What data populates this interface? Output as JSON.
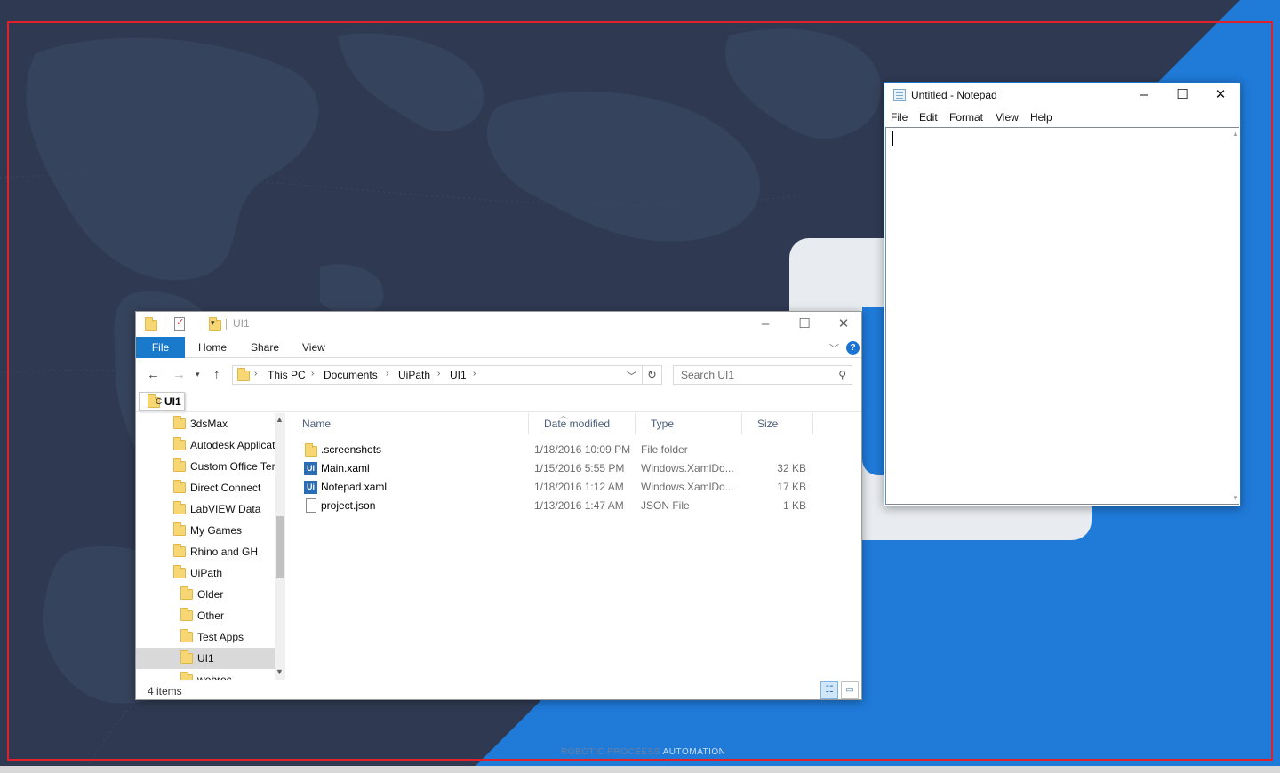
{
  "desktop": {
    "caption_dim": "ROBOTIC PROCEESS",
    "caption_bright": "AUTOMATION"
  },
  "explorer": {
    "title": "UI1",
    "ribbon_tabs": [
      "File",
      "Home",
      "Share",
      "View"
    ],
    "help_label": "?",
    "breadcrumb": [
      "This PC",
      "Documents",
      "UiPath",
      "UI1"
    ],
    "search_placeholder": "Search UI1",
    "drag_tab": {
      "letter": "C",
      "label": "UI1"
    },
    "tree": [
      {
        "label": "3dsMax",
        "level": 0
      },
      {
        "label": "Autodesk Applicat",
        "level": 0
      },
      {
        "label": "Custom Office Ter",
        "level": 0
      },
      {
        "label": "Direct Connect",
        "level": 0
      },
      {
        "label": "LabVIEW Data",
        "level": 0
      },
      {
        "label": "My Games",
        "level": 0
      },
      {
        "label": "Rhino and GH",
        "level": 0
      },
      {
        "label": "UiPath",
        "level": 0
      },
      {
        "label": "Older",
        "level": 1
      },
      {
        "label": "Other",
        "level": 1
      },
      {
        "label": "Test Apps",
        "level": 1
      },
      {
        "label": "UI1",
        "level": 1,
        "selected": true
      },
      {
        "label": "webrec",
        "level": 1
      }
    ],
    "columns": [
      "Name",
      "Date modified",
      "Type",
      "Size"
    ],
    "files": [
      {
        "icon": "folder-icon",
        "name": ".screenshots",
        "date": "1/18/2016 10:09 PM",
        "type": "File folder",
        "size": ""
      },
      {
        "icon": "uipath-file-icon",
        "name": "Main.xaml",
        "date": "1/15/2016 5:55 PM",
        "type": "Windows.XamlDo...",
        "size": "32 KB"
      },
      {
        "icon": "uipath-file-icon",
        "name": "Notepad.xaml",
        "date": "1/18/2016 1:12 AM",
        "type": "Windows.XamlDo...",
        "size": "17 KB"
      },
      {
        "icon": "document-icon",
        "name": "project.json",
        "date": "1/13/2016 1:47 AM",
        "type": "JSON File",
        "size": "1 KB"
      }
    ],
    "status": "4 items",
    "ui_icon_text": "Ui"
  },
  "notepad": {
    "title": "Untitled - Notepad",
    "menu": [
      "File",
      "Edit",
      "Format",
      "View",
      "Help"
    ],
    "content": ""
  },
  "colors": {
    "desktop_bg": "#2f3a52",
    "accent_blue": "#1f7ad8",
    "ribbon_file": "#1979ca",
    "frame_red": "#e0202a"
  }
}
